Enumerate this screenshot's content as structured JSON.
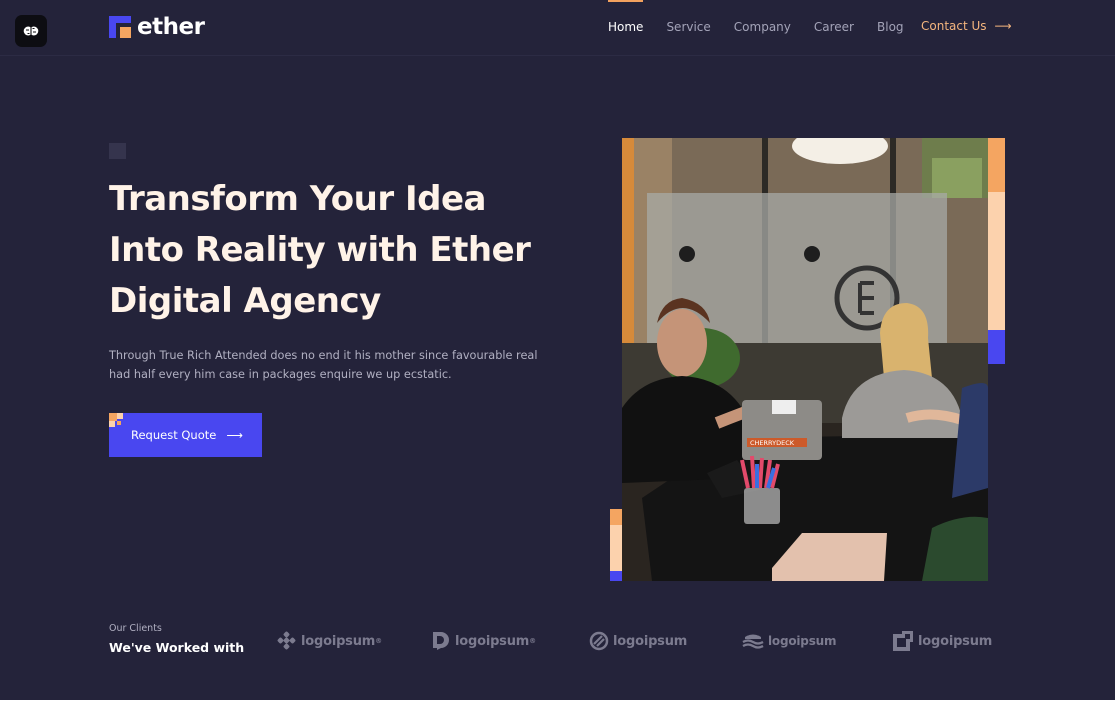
{
  "brand": {
    "name": "ether",
    "colors": {
      "accent_orange": "#f4a561",
      "accent_blue": "#4947f0",
      "background": "#24233a",
      "peach": "#fcd2ad"
    }
  },
  "nav": {
    "items": [
      {
        "label": "Home",
        "active": true
      },
      {
        "label": "Service",
        "active": false
      },
      {
        "label": "Company",
        "active": false
      },
      {
        "label": "Career",
        "active": false
      },
      {
        "label": "Blog",
        "active": false
      }
    ],
    "contact_label": "Contact Us",
    "contact_arrow": "⟶"
  },
  "hero": {
    "title_lines": [
      "Transform Your Idea",
      "Into Reality with Ether",
      "Digital Agency"
    ],
    "description_lines": [
      "Through True Rich Attended does no end it his mother since favourable real",
      "had half every him case in packages enquire we up ecstatic."
    ],
    "cta_label": "Request Quote",
    "cta_arrow": "⟶",
    "laptop_sticker": "CHERRYDECK"
  },
  "clients": {
    "eyebrow": "Our Clients",
    "heading": "We've Worked with",
    "logos": [
      {
        "name": "logoipsum",
        "mark": "®",
        "icon": "cluster-icon"
      },
      {
        "name": "logoipsum",
        "mark": "®",
        "icon": "d-shape-icon"
      },
      {
        "name": "logoipsum",
        "mark": "",
        "icon": "slash-circle-icon"
      },
      {
        "name": "logoipsum",
        "mark": "",
        "icon": "waves-icon"
      },
      {
        "name": "logoipsum",
        "mark": "",
        "icon": "square-notch-icon"
      }
    ]
  }
}
